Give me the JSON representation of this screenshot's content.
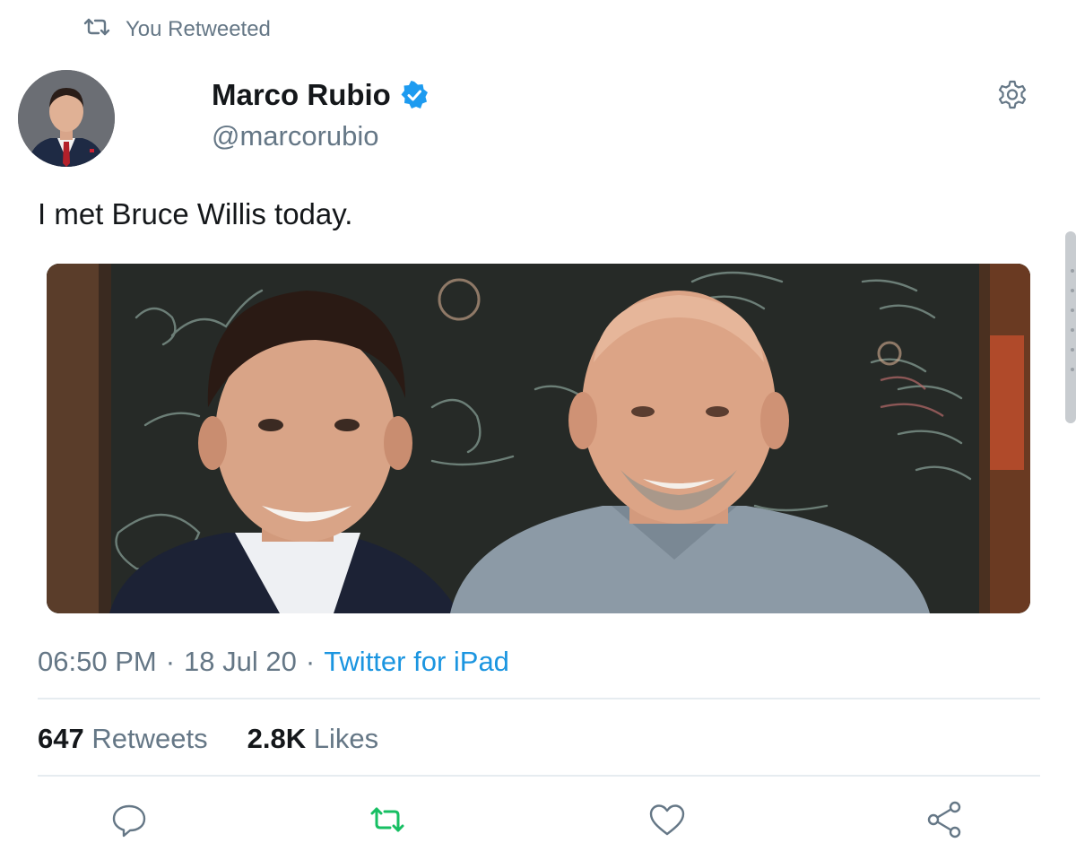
{
  "retweet_context": {
    "icon": "retweet-icon",
    "text": "You Retweeted",
    "color": "#657786"
  },
  "author": {
    "name": "Marco Rubio",
    "handle": "@marcorubio",
    "verified": true,
    "verified_color": "#1d9bf0"
  },
  "tweet": {
    "text": "I met Bruce Willis today.",
    "time": "06:50 PM",
    "date": "18 Jul 20",
    "separator": "·",
    "source": "Twitter for iPad",
    "source_color": "#1b95e0"
  },
  "stats": {
    "retweets_count": "647",
    "retweets_label": "Retweets",
    "likes_count": "2.8K",
    "likes_label": "Likes"
  },
  "actions": [
    {
      "icon": "reply-icon"
    },
    {
      "icon": "retweet-icon",
      "active": true,
      "color": "#17bf63"
    },
    {
      "icon": "like-icon"
    },
    {
      "icon": "share-icon"
    }
  ],
  "colors": {
    "text_primary": "#14171a",
    "text_secondary": "#657786",
    "link": "#1b95e0",
    "retweet_active": "#17bf63",
    "divider": "#e6ecf0"
  }
}
